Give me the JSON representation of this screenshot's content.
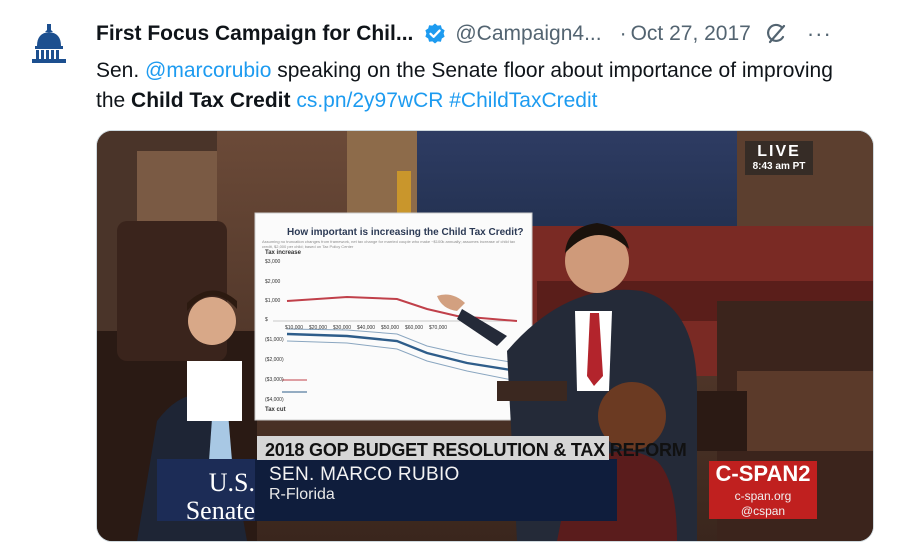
{
  "tweet": {
    "author_name": "First Focus Campaign for Chil...",
    "handle": "@Campaign4...",
    "separator": "·",
    "date": "Oct 27, 2017",
    "more_label": "···",
    "verified": true,
    "text": {
      "part1": "Sen. ",
      "mention": "@marcorubio",
      "part2": " speaking on the Senate floor about importance of improving the ",
      "bold": "Child Tax Credit",
      "space1": " ",
      "url": "cs.pn/2y97wCR",
      "space2": " ",
      "hashtag": "#ChildTaxCredit"
    }
  },
  "video": {
    "live_label": "LIVE",
    "live_time": "8:43 am PT",
    "chyron_title": "2018 GOP BUDGET RESOLUTION & TAX REFORM",
    "chyron_name": "SEN. MARCO RUBIO",
    "chyron_party": "R-Florida",
    "network_us": "U.S.",
    "network_senate": "Senate",
    "cspan_logo": "C-SPAN2",
    "cspan_url": "c-span.org",
    "cspan_handle": "@cspan"
  },
  "board": {
    "title": "How important is increasing the Child Tax Credit?",
    "subtitle": "Assuming no truncation changes from framework, net tax change for married couple who make ~$100k annually; assumes increase of child tax credit, $2,000 per child; based on Tax Policy Center",
    "y_axis_top": "Tax increase",
    "y_axis_bottom": "Tax cut",
    "y_ticks": [
      "$3,000",
      "$2,000",
      "$1,000",
      "$",
      "($1,000)",
      "($2,000)",
      "($3,000)",
      "($4,000)"
    ],
    "x_ticks": [
      "$10,000",
      "$20,000",
      "$30,000",
      "$40,000",
      "$50,000",
      "$60,000",
      "$70,000"
    ]
  },
  "colors": {
    "link": "#1d9bf0",
    "verified": "#1d9bf0",
    "secondary_text": "#536471",
    "cspan_red": "#c0201f",
    "chyron_bar": "#d6d6d6",
    "chyron_navy": "#0f1d3c"
  }
}
